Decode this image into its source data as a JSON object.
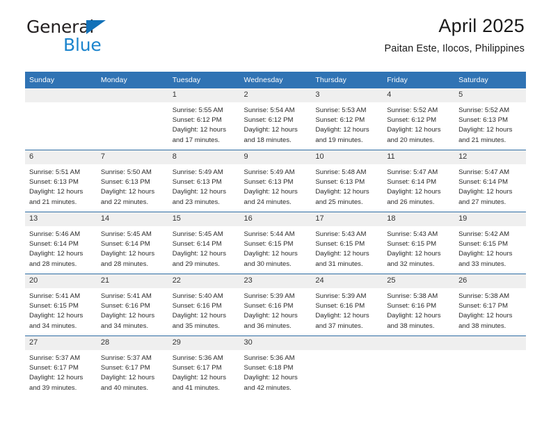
{
  "brand": {
    "name_part1": "General",
    "name_part2": "Blue",
    "triangle_icon": "triangle-right-icon",
    "accent_color": "#1b84cd"
  },
  "header": {
    "title": "April 2025",
    "location": "Paitan Este, Ilocos, Philippines",
    "header_bg_color": "#3073b4",
    "daynum_bg_color": "#efefef",
    "row_divider_color": "#2e6da4"
  },
  "weekdays": [
    "Sunday",
    "Monday",
    "Tuesday",
    "Wednesday",
    "Thursday",
    "Friday",
    "Saturday"
  ],
  "labels": {
    "sunrise_prefix": "Sunrise:",
    "sunset_prefix": "Sunset:",
    "daylight_prefix": "Daylight:"
  },
  "weeks": [
    [
      {
        "day": "",
        "sunrise": "",
        "sunset": "",
        "daylight_line1": "",
        "daylight_line2": ""
      },
      {
        "day": "",
        "sunrise": "",
        "sunset": "",
        "daylight_line1": "",
        "daylight_line2": ""
      },
      {
        "day": "1",
        "sunrise": "Sunrise: 5:55 AM",
        "sunset": "Sunset: 6:12 PM",
        "daylight_line1": "Daylight: 12 hours",
        "daylight_line2": "and 17 minutes."
      },
      {
        "day": "2",
        "sunrise": "Sunrise: 5:54 AM",
        "sunset": "Sunset: 6:12 PM",
        "daylight_line1": "Daylight: 12 hours",
        "daylight_line2": "and 18 minutes."
      },
      {
        "day": "3",
        "sunrise": "Sunrise: 5:53 AM",
        "sunset": "Sunset: 6:12 PM",
        "daylight_line1": "Daylight: 12 hours",
        "daylight_line2": "and 19 minutes."
      },
      {
        "day": "4",
        "sunrise": "Sunrise: 5:52 AM",
        "sunset": "Sunset: 6:12 PM",
        "daylight_line1": "Daylight: 12 hours",
        "daylight_line2": "and 20 minutes."
      },
      {
        "day": "5",
        "sunrise": "Sunrise: 5:52 AM",
        "sunset": "Sunset: 6:13 PM",
        "daylight_line1": "Daylight: 12 hours",
        "daylight_line2": "and 21 minutes."
      }
    ],
    [
      {
        "day": "6",
        "sunrise": "Sunrise: 5:51 AM",
        "sunset": "Sunset: 6:13 PM",
        "daylight_line1": "Daylight: 12 hours",
        "daylight_line2": "and 21 minutes."
      },
      {
        "day": "7",
        "sunrise": "Sunrise: 5:50 AM",
        "sunset": "Sunset: 6:13 PM",
        "daylight_line1": "Daylight: 12 hours",
        "daylight_line2": "and 22 minutes."
      },
      {
        "day": "8",
        "sunrise": "Sunrise: 5:49 AM",
        "sunset": "Sunset: 6:13 PM",
        "daylight_line1": "Daylight: 12 hours",
        "daylight_line2": "and 23 minutes."
      },
      {
        "day": "9",
        "sunrise": "Sunrise: 5:49 AM",
        "sunset": "Sunset: 6:13 PM",
        "daylight_line1": "Daylight: 12 hours",
        "daylight_line2": "and 24 minutes."
      },
      {
        "day": "10",
        "sunrise": "Sunrise: 5:48 AM",
        "sunset": "Sunset: 6:13 PM",
        "daylight_line1": "Daylight: 12 hours",
        "daylight_line2": "and 25 minutes."
      },
      {
        "day": "11",
        "sunrise": "Sunrise: 5:47 AM",
        "sunset": "Sunset: 6:14 PM",
        "daylight_line1": "Daylight: 12 hours",
        "daylight_line2": "and 26 minutes."
      },
      {
        "day": "12",
        "sunrise": "Sunrise: 5:47 AM",
        "sunset": "Sunset: 6:14 PM",
        "daylight_line1": "Daylight: 12 hours",
        "daylight_line2": "and 27 minutes."
      }
    ],
    [
      {
        "day": "13",
        "sunrise": "Sunrise: 5:46 AM",
        "sunset": "Sunset: 6:14 PM",
        "daylight_line1": "Daylight: 12 hours",
        "daylight_line2": "and 28 minutes."
      },
      {
        "day": "14",
        "sunrise": "Sunrise: 5:45 AM",
        "sunset": "Sunset: 6:14 PM",
        "daylight_line1": "Daylight: 12 hours",
        "daylight_line2": "and 28 minutes."
      },
      {
        "day": "15",
        "sunrise": "Sunrise: 5:45 AM",
        "sunset": "Sunset: 6:14 PM",
        "daylight_line1": "Daylight: 12 hours",
        "daylight_line2": "and 29 minutes."
      },
      {
        "day": "16",
        "sunrise": "Sunrise: 5:44 AM",
        "sunset": "Sunset: 6:15 PM",
        "daylight_line1": "Daylight: 12 hours",
        "daylight_line2": "and 30 minutes."
      },
      {
        "day": "17",
        "sunrise": "Sunrise: 5:43 AM",
        "sunset": "Sunset: 6:15 PM",
        "daylight_line1": "Daylight: 12 hours",
        "daylight_line2": "and 31 minutes."
      },
      {
        "day": "18",
        "sunrise": "Sunrise: 5:43 AM",
        "sunset": "Sunset: 6:15 PM",
        "daylight_line1": "Daylight: 12 hours",
        "daylight_line2": "and 32 minutes."
      },
      {
        "day": "19",
        "sunrise": "Sunrise: 5:42 AM",
        "sunset": "Sunset: 6:15 PM",
        "daylight_line1": "Daylight: 12 hours",
        "daylight_line2": "and 33 minutes."
      }
    ],
    [
      {
        "day": "20",
        "sunrise": "Sunrise: 5:41 AM",
        "sunset": "Sunset: 6:15 PM",
        "daylight_line1": "Daylight: 12 hours",
        "daylight_line2": "and 34 minutes."
      },
      {
        "day": "21",
        "sunrise": "Sunrise: 5:41 AM",
        "sunset": "Sunset: 6:16 PM",
        "daylight_line1": "Daylight: 12 hours",
        "daylight_line2": "and 34 minutes."
      },
      {
        "day": "22",
        "sunrise": "Sunrise: 5:40 AM",
        "sunset": "Sunset: 6:16 PM",
        "daylight_line1": "Daylight: 12 hours",
        "daylight_line2": "and 35 minutes."
      },
      {
        "day": "23",
        "sunrise": "Sunrise: 5:39 AM",
        "sunset": "Sunset: 6:16 PM",
        "daylight_line1": "Daylight: 12 hours",
        "daylight_line2": "and 36 minutes."
      },
      {
        "day": "24",
        "sunrise": "Sunrise: 5:39 AM",
        "sunset": "Sunset: 6:16 PM",
        "daylight_line1": "Daylight: 12 hours",
        "daylight_line2": "and 37 minutes."
      },
      {
        "day": "25",
        "sunrise": "Sunrise: 5:38 AM",
        "sunset": "Sunset: 6:16 PM",
        "daylight_line1": "Daylight: 12 hours",
        "daylight_line2": "and 38 minutes."
      },
      {
        "day": "26",
        "sunrise": "Sunrise: 5:38 AM",
        "sunset": "Sunset: 6:17 PM",
        "daylight_line1": "Daylight: 12 hours",
        "daylight_line2": "and 38 minutes."
      }
    ],
    [
      {
        "day": "27",
        "sunrise": "Sunrise: 5:37 AM",
        "sunset": "Sunset: 6:17 PM",
        "daylight_line1": "Daylight: 12 hours",
        "daylight_line2": "and 39 minutes."
      },
      {
        "day": "28",
        "sunrise": "Sunrise: 5:37 AM",
        "sunset": "Sunset: 6:17 PM",
        "daylight_line1": "Daylight: 12 hours",
        "daylight_line2": "and 40 minutes."
      },
      {
        "day": "29",
        "sunrise": "Sunrise: 5:36 AM",
        "sunset": "Sunset: 6:17 PM",
        "daylight_line1": "Daylight: 12 hours",
        "daylight_line2": "and 41 minutes."
      },
      {
        "day": "30",
        "sunrise": "Sunrise: 5:36 AM",
        "sunset": "Sunset: 6:18 PM",
        "daylight_line1": "Daylight: 12 hours",
        "daylight_line2": "and 42 minutes."
      },
      {
        "day": "",
        "sunrise": "",
        "sunset": "",
        "daylight_line1": "",
        "daylight_line2": ""
      },
      {
        "day": "",
        "sunrise": "",
        "sunset": "",
        "daylight_line1": "",
        "daylight_line2": ""
      },
      {
        "day": "",
        "sunrise": "",
        "sunset": "",
        "daylight_line1": "",
        "daylight_line2": ""
      }
    ]
  ]
}
